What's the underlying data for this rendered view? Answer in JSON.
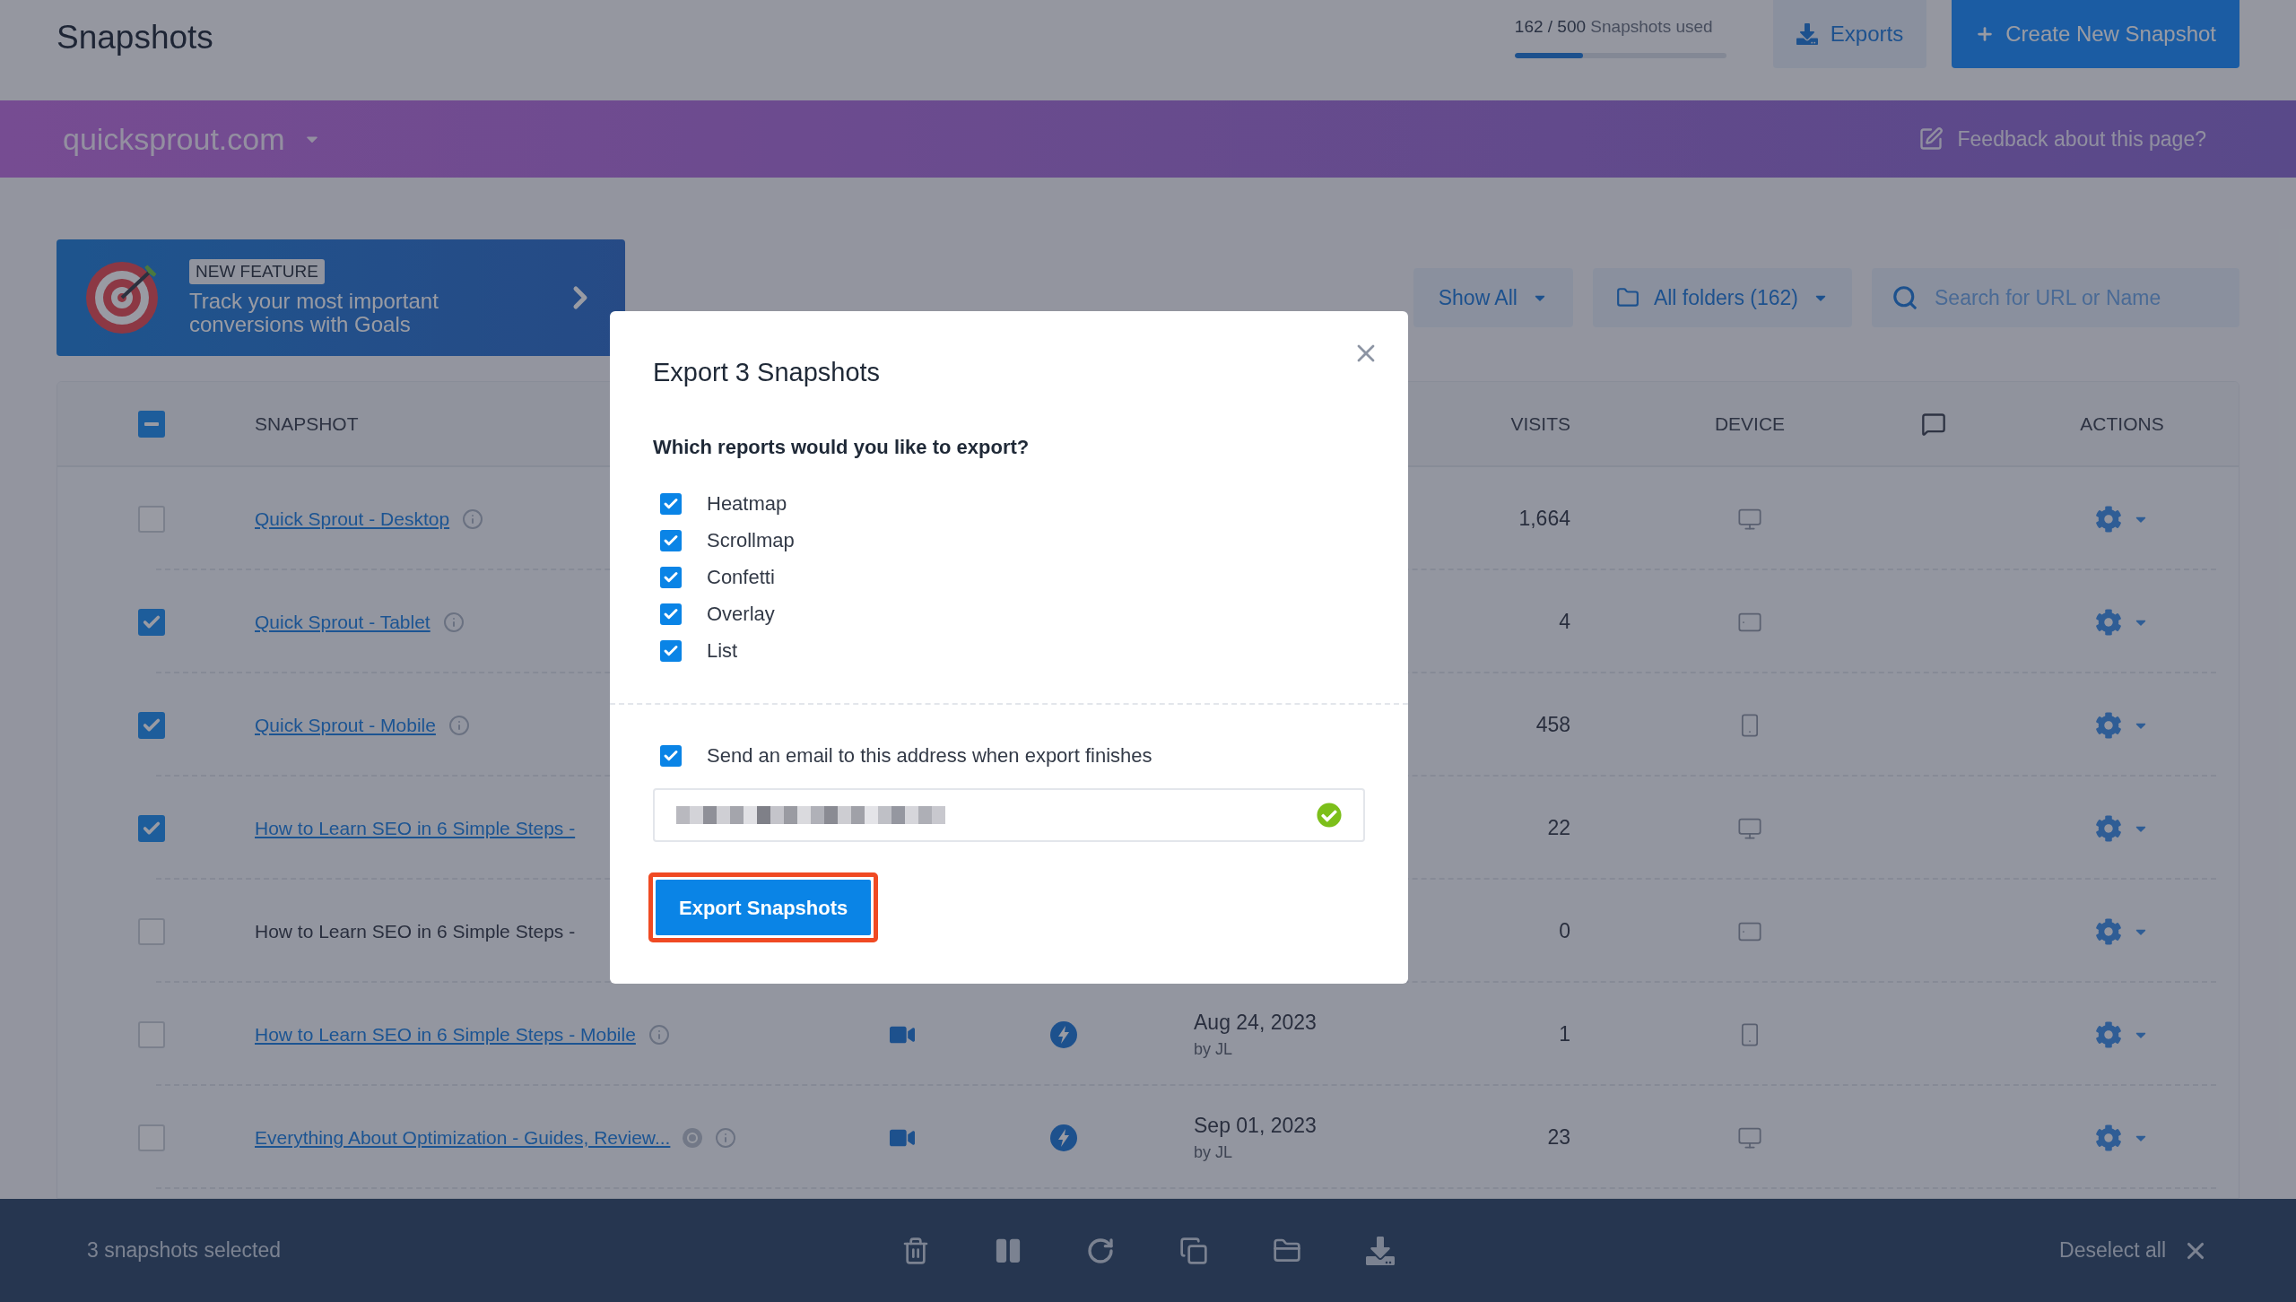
{
  "header": {
    "title": "Snapshots",
    "usage": {
      "count": "162 / 500",
      "text": "Snapshots used",
      "level": 0.324
    },
    "buttons": [
      {
        "kind": "secondary",
        "label": "Exports"
      },
      {
        "kind": "primary",
        "label": "Create New Snapshot"
      }
    ]
  },
  "site_bar": {
    "site": "quicksprout.com",
    "feedback": "Feedback about this page?"
  },
  "banner": {
    "tag": "NEW FEATURE",
    "text": "Track your most important conversions with Goals"
  },
  "filters": {
    "show": "Show All",
    "folders": "All folders (162)",
    "search": {
      "placeholder": "Search for URL or Name"
    }
  },
  "table": {
    "select_all": {
      "indeterminate": true
    },
    "columns": {
      "snapshot": "SNAPSHOT",
      "visits": "VISITS",
      "device": "DEVICE",
      "actions": "ACTIONS"
    },
    "rows": [
      {
        "name": "Quick Sprout - Desktop",
        "link": true,
        "checked": false,
        "info": true,
        "goal": false,
        "recording": false,
        "visits": "1,664",
        "device": {
          "kind": "desktop"
        }
      },
      {
        "name": "Quick Sprout - Tablet",
        "link": true,
        "checked": true,
        "info": true,
        "goal": false,
        "recording": false,
        "visits": "4",
        "device": {
          "kind": "tablet"
        }
      },
      {
        "name": "Quick Sprout - Mobile",
        "link": true,
        "checked": true,
        "info": true,
        "goal": false,
        "recording": false,
        "visits": "458",
        "device": {
          "kind": "mobile"
        }
      },
      {
        "name": "How to Learn SEO in 6 Simple Steps -",
        "link": true,
        "checked": true,
        "info": false,
        "goal": false,
        "recording": false,
        "visits": "22",
        "device": {
          "kind": "desktop"
        }
      },
      {
        "name": "How to Learn SEO in 6 Simple Steps -",
        "link": false,
        "checked": false,
        "info": false,
        "goal": false,
        "recording": false,
        "visits": "0",
        "device": {
          "kind": "tablet"
        }
      },
      {
        "name": "How to Learn SEO in 6 Simple Steps - Mobile",
        "link": true,
        "checked": false,
        "info": true,
        "goal": false,
        "recording": true,
        "date": "Aug 24, 2023",
        "by": "by JL",
        "visits": "1",
        "device": {
          "kind": "mobile"
        }
      },
      {
        "name": "Everything About Optimization - Guides, Review...",
        "link": true,
        "checked": false,
        "info": true,
        "goal": true,
        "recording": true,
        "date": "Sep 01, 2023",
        "by": "by JL",
        "visits": "23",
        "device": {
          "kind": "desktop"
        }
      }
    ]
  },
  "modal": {
    "title": "Export 3 Snapshots",
    "question": "Which reports would you like to export?",
    "options": [
      {
        "label": "Heatmap",
        "checked": true
      },
      {
        "label": "Scrollmap",
        "checked": true
      },
      {
        "label": "Confetti",
        "checked": true
      },
      {
        "label": "Overlay",
        "checked": true
      },
      {
        "label": "List",
        "checked": true
      }
    ],
    "email": {
      "label": "Send an email to this address when export finishes",
      "checked": true
    },
    "email_field": {
      "valid": true
    },
    "button": "Export Snapshots"
  },
  "selection_bar": {
    "count": "3 snapshots selected",
    "deselect": "Deselect all"
  }
}
